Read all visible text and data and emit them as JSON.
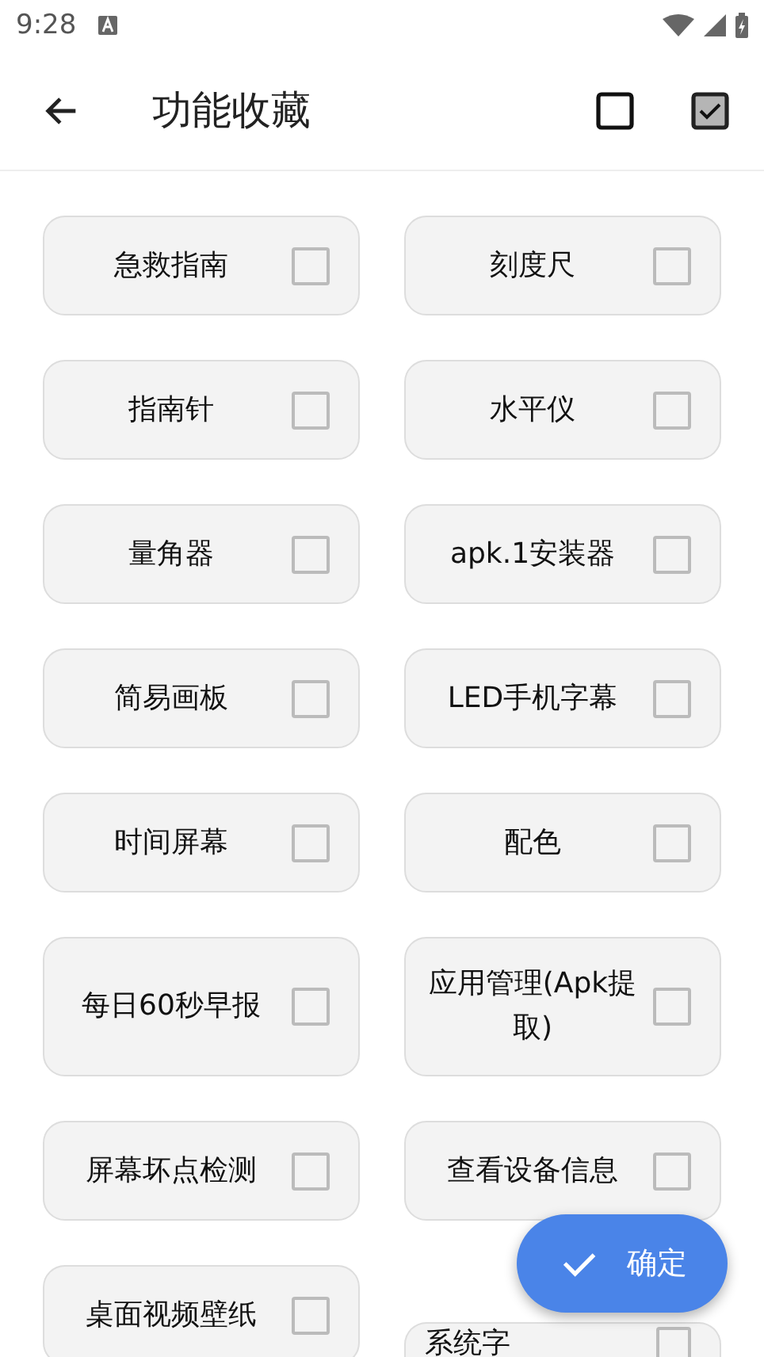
{
  "status_bar": {
    "time": "9:28"
  },
  "app_bar": {
    "title": "功能收藏"
  },
  "items": [
    {
      "label": "急救指南",
      "checked": false
    },
    {
      "label": "刻度尺",
      "checked": false
    },
    {
      "label": "指南针",
      "checked": false
    },
    {
      "label": "水平仪",
      "checked": false
    },
    {
      "label": "量角器",
      "checked": false
    },
    {
      "label": "apk.1安装器",
      "checked": false
    },
    {
      "label": "简易画板",
      "checked": false
    },
    {
      "label": "LED手机字幕",
      "checked": false
    },
    {
      "label": "时间屏幕",
      "checked": false
    },
    {
      "label": "配色",
      "checked": false
    },
    {
      "label": "每日60秒早报",
      "checked": false
    },
    {
      "label": "应用管理(Apk提取)",
      "checked": false
    },
    {
      "label": "屏幕坏点检测",
      "checked": false
    },
    {
      "label": "查看设备信息",
      "checked": false
    },
    {
      "label": "桌面视频壁纸",
      "checked": false
    },
    {
      "label": "系统字",
      "checked": false,
      "kind": "cut"
    }
  ],
  "fab": {
    "label": "确定"
  }
}
